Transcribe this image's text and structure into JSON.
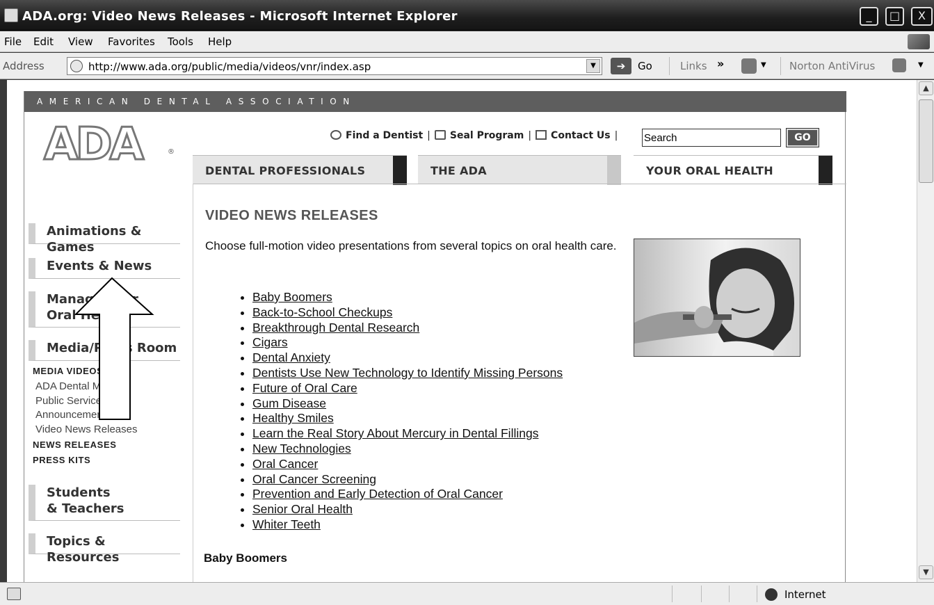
{
  "window": {
    "title": "ADA.org: Video News Releases - Microsoft Internet Explorer",
    "minimize": "_",
    "maximize": "□",
    "close": "X"
  },
  "menu": [
    "File",
    "Edit",
    "View",
    "Favorites",
    "Tools",
    "Help"
  ],
  "address": {
    "label": "Address",
    "url": "http://www.ada.org/public/media/videos/vnr/index.asp",
    "go_label": "Go",
    "links_label": "Links",
    "links_chevron": "»",
    "norton_label": "Norton AntiVirus"
  },
  "site": {
    "band": "AMERICAN DENTAL ASSOCIATION",
    "logo": "ADA",
    "logo_reg": "®",
    "toplinks": [
      "Find a Dentist",
      "Seal Program",
      "Contact Us"
    ],
    "search_value": "Search",
    "search_button": "GO",
    "tabs": [
      "DENTAL PROFESSIONALS",
      "THE ADA",
      "YOUR ORAL HEALTH"
    ]
  },
  "nav": {
    "animations": "Animations & Games",
    "events": "Events & News",
    "manage": "Manage Your\nOral Health",
    "media": "Media/Press Room",
    "media_videos_head": "MEDIA VIDEOS",
    "sub_minutes": "ADA Dental Minutes",
    "sub_psa": "Public Service\nAnnouncements",
    "sub_vnr": "Video News Releases",
    "news_releases": "NEWS RELEASES",
    "press_kits": "PRESS KITS",
    "students": "Students\n& Teachers",
    "topics": "Topics & Resources"
  },
  "main": {
    "heading": "VIDEO NEWS RELEASES",
    "intro": "Choose full-motion video presentations from several topics on oral health care.",
    "topics": [
      "Baby Boomers",
      "Back-to-School Checkups",
      "Breakthrough Dental Research",
      "Cigars",
      "Dental Anxiety",
      "Dentists Use New Technology to Identify Missing Persons",
      "Future of Oral Care",
      "Gum Disease",
      "Healthy Smiles",
      "Learn the Real Story About Mercury in Dental Fillings",
      "New Technologies",
      "Oral Cancer",
      "Oral Cancer Screening",
      "Prevention and Early Detection of Oral Cancer",
      "Senior Oral Health",
      "Whiter Teeth"
    ],
    "section_head": "Baby Boomers"
  },
  "status": {
    "zone": "Internet"
  },
  "colors": {
    "titlebar": "#1e1e1e",
    "band": "#5e5e5e",
    "tab_inactive": "#e6e6e6",
    "tab_accent": "#222222",
    "nav_accent": "#cfcfcf"
  }
}
